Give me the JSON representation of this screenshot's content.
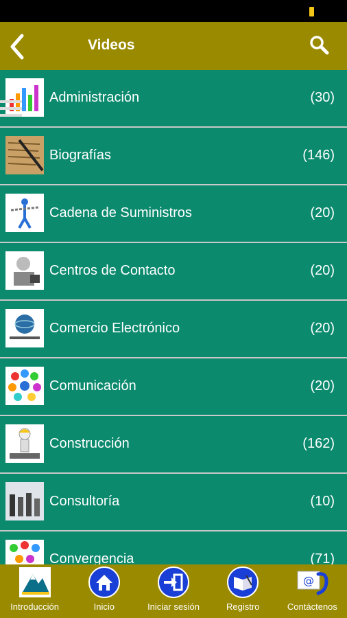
{
  "header": {
    "title": "Videos"
  },
  "categories": [
    {
      "label": "Administración",
      "count": "(30)"
    },
    {
      "label": "Biografías",
      "count": "(146)"
    },
    {
      "label": "Cadena de Suministros",
      "count": "(20)"
    },
    {
      "label": "Centros de Contacto",
      "count": "(20)"
    },
    {
      "label": "Comercio Electrónico",
      "count": "(20)"
    },
    {
      "label": "Comunicación",
      "count": "(20)"
    },
    {
      "label": "Construcción",
      "count": "(162)"
    },
    {
      "label": "Consultoría",
      "count": "(10)"
    },
    {
      "label": "Convergencia",
      "count": "(71)"
    }
  ],
  "tabbar": {
    "items": [
      {
        "label": "Introducción",
        "icon": "mountain-logo-icon"
      },
      {
        "label": "Inicio",
        "icon": "home-icon"
      },
      {
        "label": "Iniciar sesión",
        "icon": "login-icon"
      },
      {
        "label": "Registro",
        "icon": "register-book-icon"
      },
      {
        "label": "Contáctenos",
        "icon": "contact-phone-icon"
      }
    ]
  },
  "colors": {
    "header": "#9a8a00",
    "list_bg": "#0b8a6e",
    "divider": "#c9c9c9",
    "tab_icon_blue": "#1a3fd6"
  }
}
